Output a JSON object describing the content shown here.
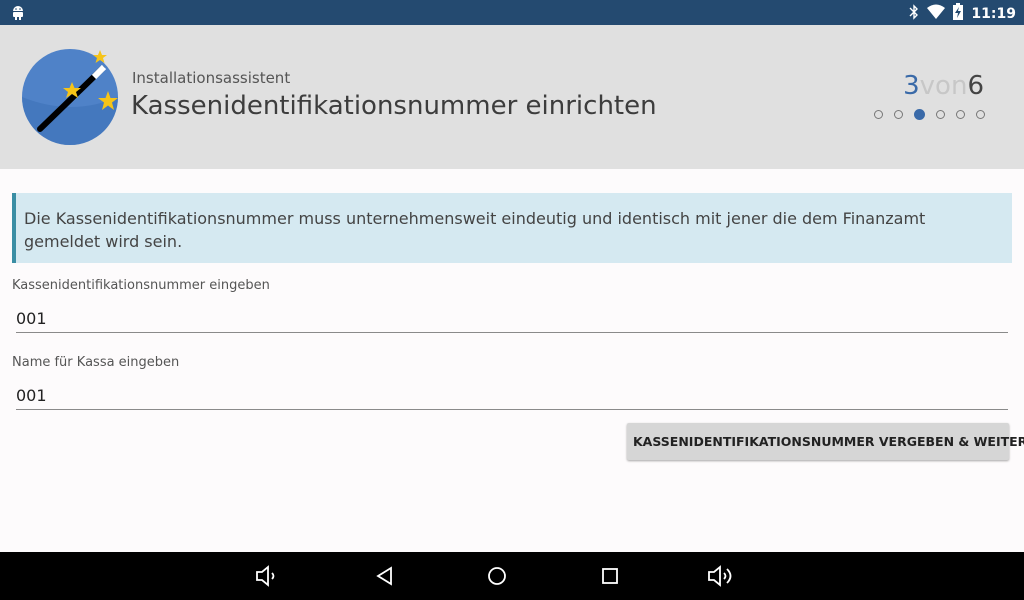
{
  "status_bar": {
    "time": "11:19",
    "icons": [
      "android-icon",
      "bluetooth-icon",
      "wifi-icon",
      "battery-charging-icon"
    ]
  },
  "header": {
    "subtitle": "Installationsassistent",
    "title": "Kassenidentifikationsnummer einrichten",
    "step": {
      "current": "3",
      "separator": "von",
      "total": "6"
    },
    "progress": {
      "total_steps": 6,
      "active_index": 2
    }
  },
  "info_box": {
    "text": "Die Kassenidentifikationsnummer muss unternehmensweit eindeutig und identisch mit jener die dem Finanzamt gemeldet wird sein."
  },
  "form": {
    "cashier_id": {
      "label": "Kassenidentifikationsnummer eingeben",
      "value": "001"
    },
    "register_name": {
      "label": "Name für Kassa eingeben",
      "value": "001"
    },
    "submit_label": "KASSENIDENTIFIKATIONSNUMMER VERGEBEN & WEITER"
  },
  "nav_bar": {
    "icons": [
      "volume-down-icon",
      "back-icon",
      "home-icon",
      "recents-icon",
      "volume-up-icon"
    ]
  },
  "colors": {
    "status_bar": "#244a70",
    "header_bg": "#e0e0e0",
    "accent": "#3a6aa8",
    "info_bg": "#d5e9f1",
    "info_border": "#3a8ea4",
    "button_bg": "#d6d6d6"
  }
}
